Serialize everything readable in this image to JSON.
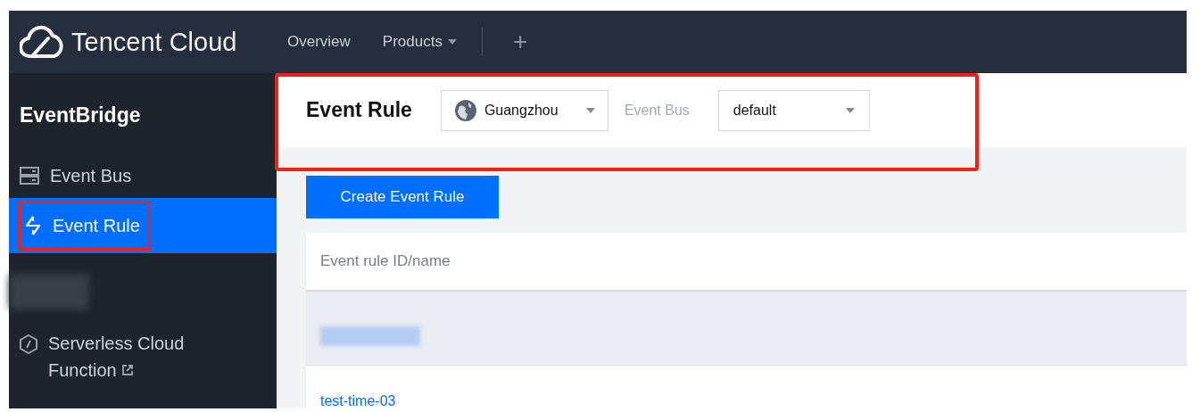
{
  "nav": {
    "brand": "Tencent Cloud",
    "items": [
      {
        "label": "Overview",
        "dropdown": false
      },
      {
        "label": "Products",
        "dropdown": true
      }
    ],
    "add": "+"
  },
  "sidebar": {
    "title": "EventBridge",
    "items": [
      {
        "kind": "link",
        "label": "Event Bus",
        "selected": false,
        "highlighted": false,
        "external": false
      },
      {
        "kind": "link",
        "label": "Event Rule",
        "selected": true,
        "highlighted": true,
        "external": false
      },
      {
        "kind": "redacted"
      },
      {
        "kind": "link",
        "label": "Serverless Cloud Function",
        "selected": false,
        "highlighted": false,
        "external": true
      }
    ]
  },
  "header": {
    "title": "Event Rule",
    "region": "Guangzhou",
    "bus_label": "Event Bus",
    "bus": "default",
    "highlighted": true
  },
  "create_button": "Create Event Rule",
  "table": {
    "columns": [
      "Event rule ID/name"
    ],
    "rows": [
      {
        "kind": "redacted"
      },
      {
        "kind": "link",
        "name": "test-time-03"
      }
    ]
  }
}
